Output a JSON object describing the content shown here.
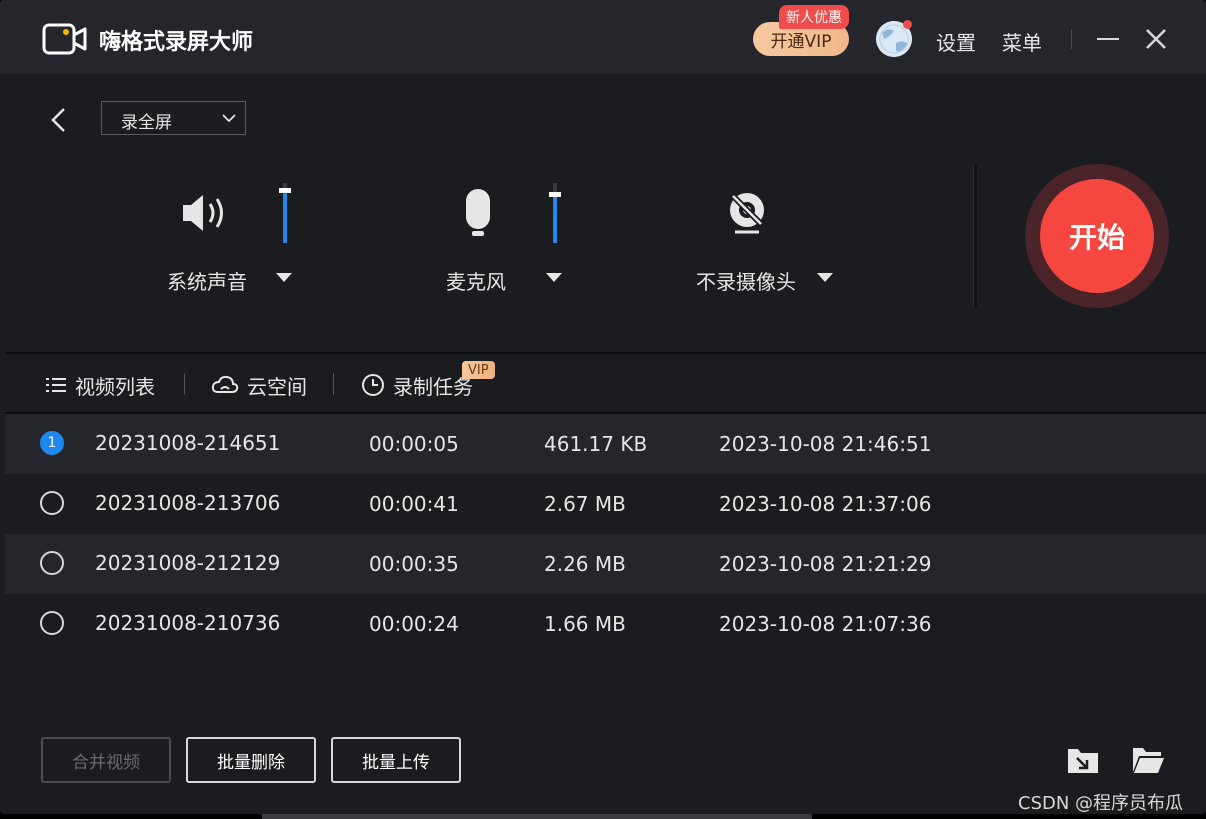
{
  "app": {
    "title": "嗨格式录屏大师"
  },
  "titlebar": {
    "vip_button": "开通VIP",
    "vip_badge": "新人优惠",
    "settings": "设置",
    "menu": "菜单"
  },
  "record": {
    "mode": "录全屏",
    "sources": [
      {
        "label": "系统声音",
        "icon": "speaker-icon",
        "level": 0.88
      },
      {
        "label": "麦克风",
        "icon": "microphone-icon",
        "level": 0.82
      },
      {
        "label": "不录摄像头",
        "icon": "camera-off-icon"
      }
    ],
    "start_label": "开始",
    "accent": "#f5473f"
  },
  "tabs": [
    {
      "label": "视频列表",
      "icon": "list-icon"
    },
    {
      "label": "云空间",
      "icon": "cloud-icon"
    },
    {
      "label": "录制任务",
      "icon": "clock-icon",
      "badge": "VIP"
    }
  ],
  "videos": [
    {
      "index": "1",
      "name": "20231008-214651",
      "duration": "00:00:05",
      "size": "461.17 KB",
      "time": "2023-10-08 21:46:51",
      "selected": true
    },
    {
      "index": "",
      "name": "20231008-213706",
      "duration": "00:00:41",
      "size": "2.67 MB",
      "time": "2023-10-08 21:37:06",
      "selected": false
    },
    {
      "index": "",
      "name": "20231008-212129",
      "duration": "00:00:35",
      "size": "2.26 MB",
      "time": "2023-10-08 21:21:29",
      "selected": false
    },
    {
      "index": "",
      "name": "20231008-210736",
      "duration": "00:00:24",
      "size": "1.66 MB",
      "time": "2023-10-08 21:07:36",
      "selected": false
    }
  ],
  "actions": {
    "merge": "合并视频",
    "batch_delete": "批量删除",
    "batch_upload": "批量上传"
  },
  "watermark": "CSDN @程序员布瓜"
}
